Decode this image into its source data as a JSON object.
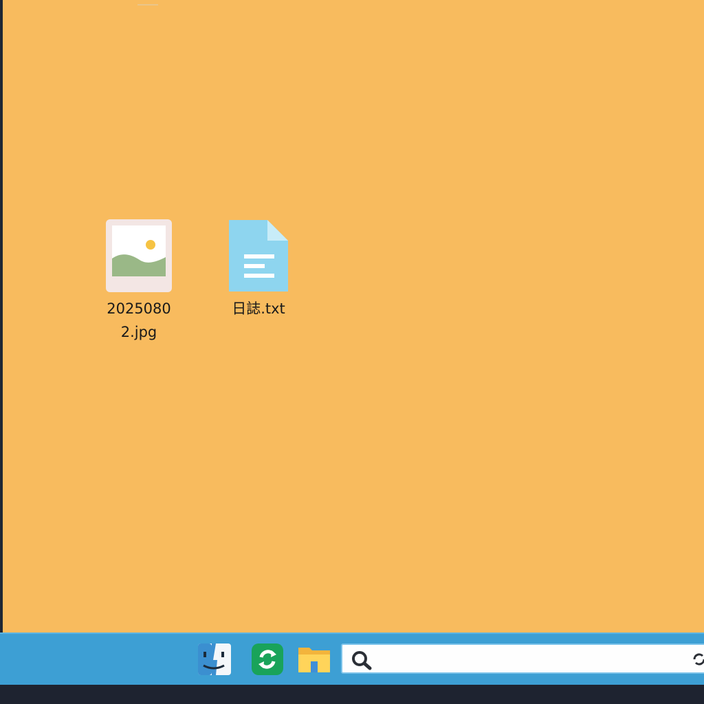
{
  "desktop": {
    "background_color": "#f8bb5e",
    "icons": [
      {
        "label": "20250802.jpg",
        "icon": "image-file-icon"
      },
      {
        "label": "日誌.txt",
        "icon": "text-document-icon"
      }
    ]
  },
  "taskbar": {
    "color": "#3d9fd4",
    "apps": [
      {
        "name": "finder-icon"
      },
      {
        "name": "sync-app-icon"
      },
      {
        "name": "file-explorer-icon"
      }
    ],
    "search": {
      "value": "",
      "placeholder": ""
    }
  }
}
